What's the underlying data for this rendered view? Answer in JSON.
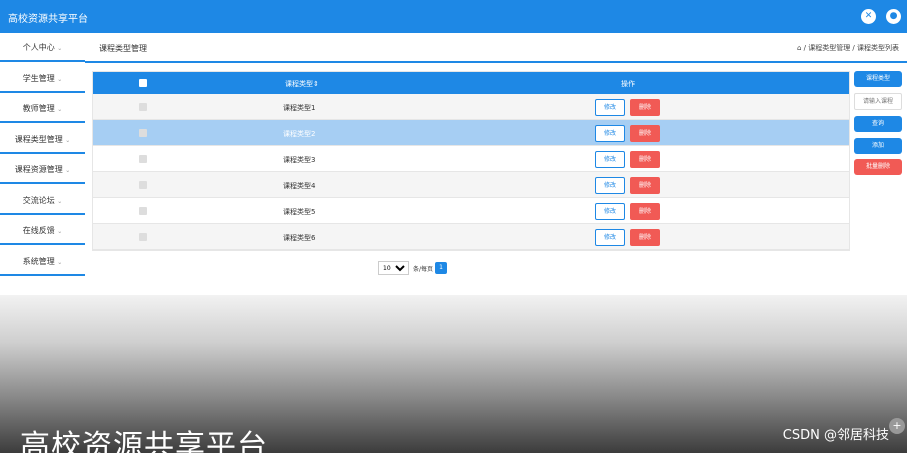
{
  "topbar": {
    "title": "高校资源共享平台",
    "icons": [
      "share-icon",
      "user-icon"
    ],
    "icon_glyphs": [
      "✕",
      "●"
    ]
  },
  "sidebar": {
    "items": [
      {
        "label": "个人中心"
      },
      {
        "label": "学生管理"
      },
      {
        "label": "教师管理"
      },
      {
        "label": "课程类型管理"
      },
      {
        "label": "课程资源管理"
      },
      {
        "label": "交流论坛"
      },
      {
        "label": "在线反馈"
      },
      {
        "label": "系统管理"
      }
    ],
    "caret": "⌄"
  },
  "header": {
    "title": "课程类型管理",
    "breadcrumb": "⌂ / 课程类型管理 / 课程类型列表"
  },
  "table": {
    "columns": [
      "课程类型⇕",
      "操作"
    ],
    "rows": [
      {
        "name": "课程类型1"
      },
      {
        "name": "课程类型2"
      },
      {
        "name": "课程类型3"
      },
      {
        "name": "课程类型4"
      },
      {
        "name": "课程类型5"
      },
      {
        "name": "课程类型6"
      }
    ],
    "edit_label": "修改",
    "delete_label": "删除"
  },
  "pager": {
    "page_size": "10",
    "per_page_label": "条/每页",
    "current_page": "1"
  },
  "right_panel": {
    "course_type_button": "课程类型",
    "search_placeholder": "请输入课程",
    "search_button": "查询",
    "add_button": "添加",
    "batch_delete_button": "批量删除"
  },
  "footer": {
    "banner_text": "高校资源共享平台",
    "watermark": "CSDN @邻居科技"
  },
  "colors": {
    "primary": "#1e88e5",
    "danger": "#f15a55",
    "highlight_row": "#a6cef3"
  }
}
